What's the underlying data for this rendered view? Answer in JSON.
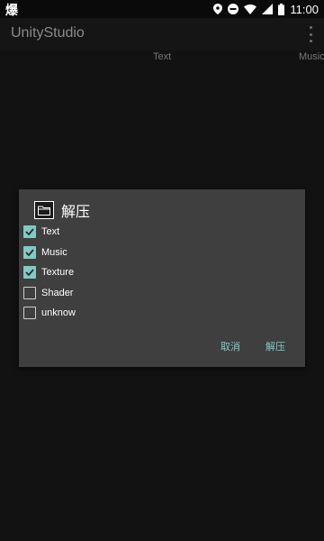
{
  "status_bar": {
    "left_glyph": "爆",
    "time": "11:00",
    "icons": [
      "location-icon",
      "do-not-disturb-icon",
      "wifi-icon",
      "signal-icon",
      "battery-icon"
    ]
  },
  "app_bar": {
    "title": "UnityStudio",
    "menu_icon": "more-vert-icon"
  },
  "tabs": [
    "Text",
    "Music"
  ],
  "dialog": {
    "title": "解压",
    "icon": "folder-icon",
    "options": [
      {
        "label": "Text",
        "checked": true
      },
      {
        "label": "Music",
        "checked": true
      },
      {
        "label": "Texture",
        "checked": true
      },
      {
        "label": "Shader",
        "checked": false
      },
      {
        "label": "unknow",
        "checked": false
      }
    ],
    "cancel_label": "取消",
    "confirm_label": "解压"
  },
  "colors": {
    "accent": "#80cbc4",
    "dialog_bg": "#3f3f3f",
    "screen_bg": "#121212"
  }
}
